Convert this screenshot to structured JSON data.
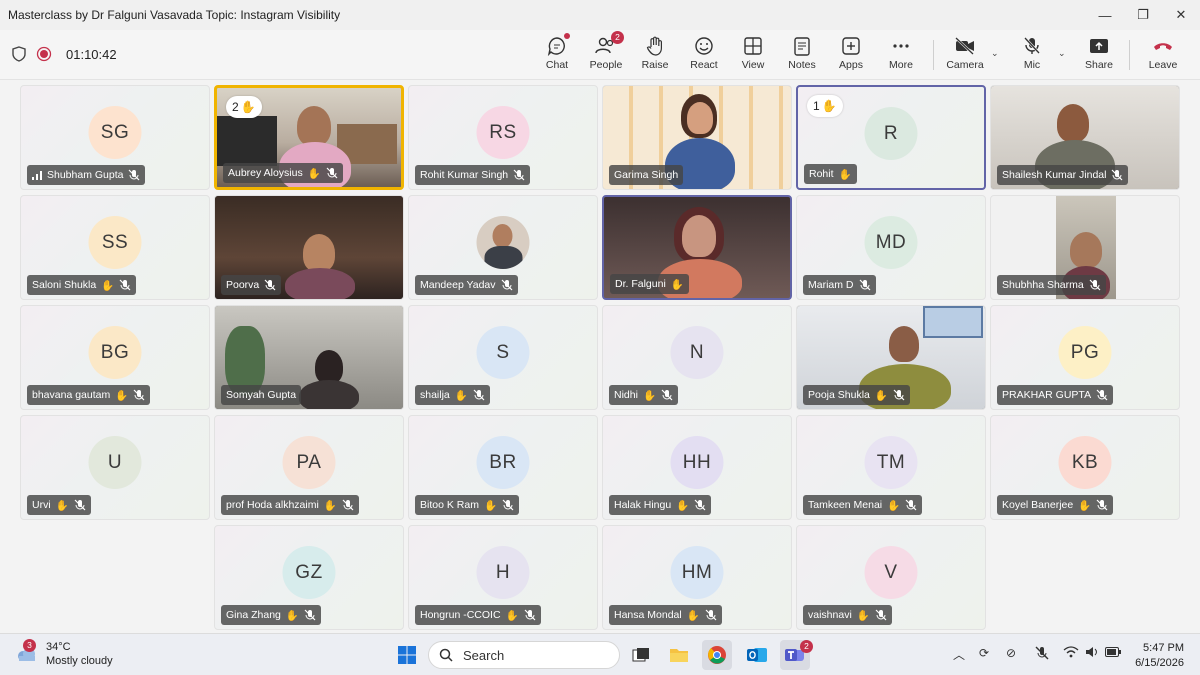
{
  "window": {
    "title": "Masterclass by Dr Falguni Vasavada Topic: Instagram Visibility"
  },
  "toolbar": {
    "timer": "01:10:42",
    "buttons": [
      {
        "label": "Chat"
      },
      {
        "label": "People",
        "badge": "2"
      },
      {
        "label": "Raise"
      },
      {
        "label": "React"
      },
      {
        "label": "View"
      },
      {
        "label": "Notes"
      },
      {
        "label": "Apps"
      },
      {
        "label": "More"
      },
      {
        "label": "Camera"
      },
      {
        "label": "Mic"
      },
      {
        "label": "Share"
      },
      {
        "label": "Leave"
      }
    ]
  },
  "participants": [
    {
      "name": "Shubham Gupta",
      "initials": "SG",
      "avatar_color": "#fde3cf"
    },
    {
      "name": "Aubrey Aloysius",
      "hand": "2"
    },
    {
      "name": "Rohit Kumar Singh",
      "initials": "RS",
      "avatar_color": "#f7d7e4"
    },
    {
      "name": "Garima Singh"
    },
    {
      "name": "Rohit",
      "initials": "R",
      "avatar_color": "#dbe9e0",
      "hand": "1"
    },
    {
      "name": "Shailesh Kumar Jindal"
    },
    {
      "name": "Saloni Shukla",
      "initials": "SS",
      "avatar_color": "#fbe8c7"
    },
    {
      "name": "Poorva"
    },
    {
      "name": "Mandeep Yadav"
    },
    {
      "name": "Dr. Falguni"
    },
    {
      "name": "Mariam D",
      "initials": "MD",
      "avatar_color": "#dcebe1"
    },
    {
      "name": "Shubhha Sharma"
    },
    {
      "name": "bhavana gautam",
      "initials": "BG",
      "avatar_color": "#fbe8c7"
    },
    {
      "name": "Somyah Gupta"
    },
    {
      "name": "shailja",
      "initials": "S",
      "avatar_color": "#d9e6f5"
    },
    {
      "name": "Nidhi",
      "initials": "N",
      "avatar_color": "#e6e3f0"
    },
    {
      "name": "Pooja Shukla"
    },
    {
      "name": "PRAKHAR GUPTA",
      "initials": "PG",
      "avatar_color": "#fdf0c6"
    },
    {
      "name": "Urvi",
      "initials": "U",
      "avatar_color": "#e2e8dc"
    },
    {
      "name": "prof Hoda alkhzaimi",
      "initials": "PA",
      "avatar_color": "#f6e1d6"
    },
    {
      "name": "Bitoo K Ram",
      "initials": "BR",
      "avatar_color": "#d9e6f5"
    },
    {
      "name": "Halak Hingu",
      "initials": "HH",
      "avatar_color": "#e3def2"
    },
    {
      "name": "Tamkeen Menai",
      "initials": "TM",
      "avatar_color": "#e8e3f2"
    },
    {
      "name": "Koyel Banerjee",
      "initials": "KB",
      "avatar_color": "#fbdad2"
    },
    {
      "name": "Gina Zhang",
      "initials": "GZ",
      "avatar_color": "#d7ecec"
    },
    {
      "name": "Hongrun -CCOIC",
      "initials": "H",
      "avatar_color": "#e6e3f0"
    },
    {
      "name": "Hansa Mondal",
      "initials": "HM",
      "avatar_color": "#d9e6f5"
    },
    {
      "name": "vaishnavi",
      "initials": "V",
      "avatar_color": "#f6dbe6"
    }
  ],
  "taskbar": {
    "weather_badge": "3",
    "temperature": "34°C",
    "condition": "Mostly cloudy",
    "search_placeholder": "Search",
    "teams_badge": "2",
    "time": "5:47 PM",
    "date": "6/15/2026"
  },
  "colors": {
    "accent": "#6264a7",
    "leave": "#c4314b",
    "raised_hand": "#f0b400"
  }
}
